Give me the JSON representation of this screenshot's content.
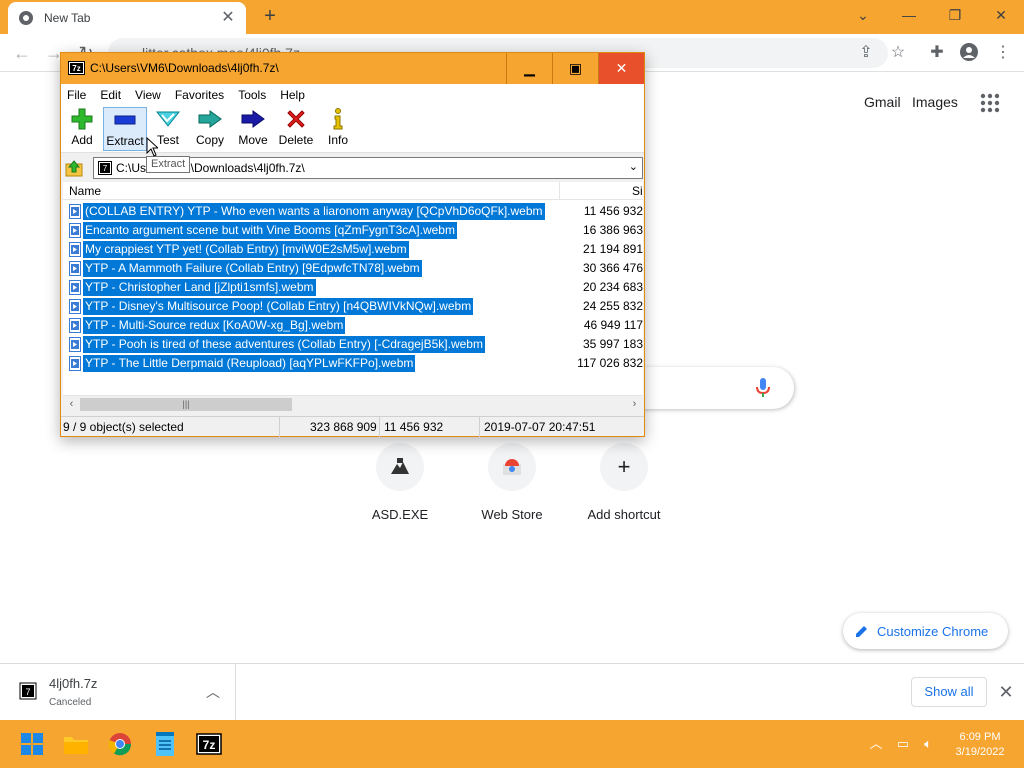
{
  "browser": {
    "tab_title": "New Tab",
    "address": "litter.catbox.moe/4lj0fh.7z",
    "header_links": {
      "gmail": "Gmail",
      "images": "Images"
    },
    "shortcuts": [
      {
        "label": "ASD.EXE"
      },
      {
        "label": "Web Store"
      },
      {
        "label": "Add shortcut"
      }
    ],
    "customize_label": "Customize Chrome"
  },
  "download": {
    "filename": "4lj0fh.7z",
    "status": "Canceled",
    "show_all": "Show all"
  },
  "taskbar": {
    "time": "6:09 PM",
    "date": "3/19/2022"
  },
  "sevenzip": {
    "title": "C:\\Users\\VM6\\Downloads\\4lj0fh.7z\\",
    "menu": [
      "File",
      "Edit",
      "View",
      "Favorites",
      "Tools",
      "Help"
    ],
    "toolbar": [
      "Add",
      "Extract",
      "Test",
      "Copy",
      "Move",
      "Delete",
      "Info"
    ],
    "tooltip": "Extract",
    "path": "C:\\Users\\VM6\\Downloads\\4lj0fh.7z\\",
    "columns": {
      "name": "Name",
      "size": "Size"
    },
    "files": [
      {
        "name": "(COLLAB ENTRY) YTP - Who even wants a liaronom anyway [QCpVhD6oQFk].webm",
        "size": "11 456 932"
      },
      {
        "name": "Encanto argument scene but with Vine Booms [qZmFygnT3cA].webm",
        "size": "16 386 963"
      },
      {
        "name": "My crappiest YTP yet! (Collab Entry) [mviW0E2sM5w].webm",
        "size": "21 194 891"
      },
      {
        "name": "YTP - A Mammoth Failure (Collab Entry) [9EdpwfcTN78].webm",
        "size": "30 366 476"
      },
      {
        "name": "YTP - Christopher Land [jZlpti1smfs].webm",
        "size": "20 234 683"
      },
      {
        "name": "YTP - Disney's Multisource Poop! (Collab Entry) [n4QBWIVkNQw].webm",
        "size": "24 255 832"
      },
      {
        "name": "YTP - Multi-Source redux [KoA0W-xg_Bg].webm",
        "size": "46 949 117"
      },
      {
        "name": "YTP - Pooh is tired of these adventures (Collab Entry) [-CdragejB5k].webm",
        "size": "35 997 183"
      },
      {
        "name": "YTP - The Little Derpmaid (Reupload) [aqYPLwFKFPo].webm",
        "size": "117 026 832"
      }
    ],
    "status": {
      "selected": "9 / 9 object(s) selected",
      "total": "323 868 909",
      "focused_size": "11 456 932",
      "modified": "2019-07-07 20:47:51"
    }
  }
}
